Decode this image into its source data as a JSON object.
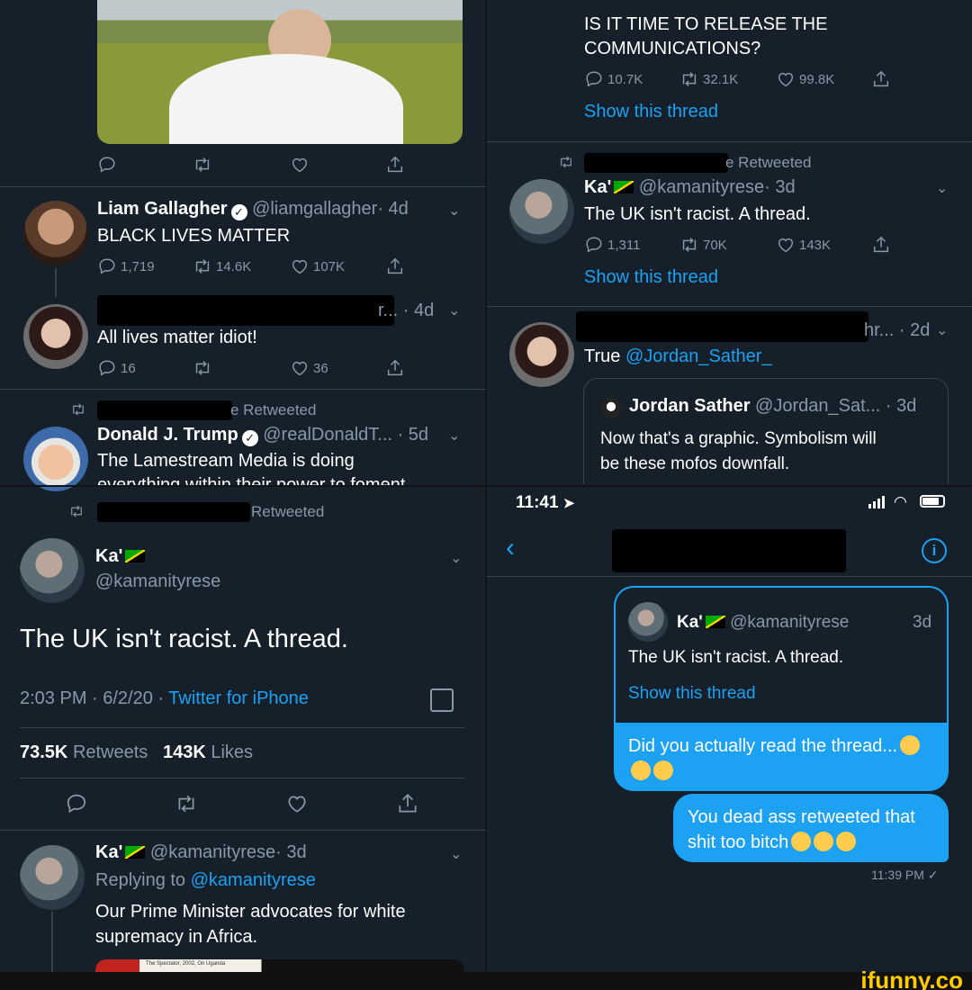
{
  "top_left": {
    "liam": {
      "name": "Liam Gallagher",
      "handle": "@liamgallagher",
      "age": "· 4d",
      "text": "BLACK LIVES MATTER",
      "replies": "1,719",
      "retweets": "14.6K",
      "likes": "107K"
    },
    "reply": {
      "name_suffix": "r...",
      "age": "· 4d",
      "text": "All lives matter idiot!",
      "replies": "16",
      "likes": "36"
    },
    "trump": {
      "retweet_label": "e Retweeted",
      "name": "Donald J. Trump",
      "handle": "@realDonaldT...",
      "age": "· 5d",
      "text": "The Lamestream Media is doing",
      "text2": "everything within their power to foment"
    }
  },
  "top_right": {
    "top_tweet": {
      "text1": "IS IT TIME TO RELEASE THE",
      "text2": "COMMUNICATIONS?",
      "replies": "10.7K",
      "retweets": "32.1K",
      "likes": "99.8K",
      "show_thread": "Show this thread"
    },
    "ka_tweet": {
      "retweet_label": "e Retweeted",
      "name": "Ka'",
      "handle": "@kamanityrese",
      "age": "· 3d",
      "text": "The UK isn't racist. A thread.",
      "replies": "1,311",
      "retweets": "70K",
      "likes": "143K",
      "show_thread": "Show this thread"
    },
    "true_tweet": {
      "name_suffix": "hr...",
      "age": "· 2d",
      "text": "True",
      "mention": "@Jordan_Sather_",
      "quote": {
        "name": "Jordan Sather",
        "handle": "@Jordan_Sat...",
        "age": "· 3d",
        "text1": "Now that's a graphic. Symbolism will",
        "text2": "be these mofos downfall."
      }
    }
  },
  "bottom_left": {
    "retweet_label": "Retweeted",
    "name": "Ka'",
    "handle": "@kamanityrese",
    "text": "The UK isn't racist. A thread.",
    "meta_time": "2:03 PM · 6/2/20 ·",
    "meta_source": "Twitter for iPhone",
    "retweets_count": "73.5K",
    "retweets_label": "Retweets",
    "likes_count": "143K",
    "likes_label": "Likes",
    "reply": {
      "name": "Ka'",
      "handle": "@kamanityrese",
      "age": "· 3d",
      "replying_to": "Replying to",
      "replying_handle": "@kamanityrese",
      "text1": "Our Prime Minister advocates for white",
      "text2": "supremacy in Africa.",
      "image_caption": "The Spectator, 2002, On Uganda"
    }
  },
  "bottom_right": {
    "status_time": "11:41",
    "shared": {
      "name": "Ka'",
      "handle": "@kamanityrese",
      "age": "3d",
      "text": "The UK isn't racist. A thread.",
      "show_thread": "Show this thread"
    },
    "msg1": "Did you actually read the thread...",
    "msg2_line1": "You dead ass retweeted that",
    "msg2_line2": "shit too bitch",
    "timestamp": "11:39 PM ✓"
  },
  "watermark": "ifunny.co",
  "colors": {
    "background": "#15202b",
    "accent": "#1da1f2",
    "muted": "#8899a6"
  }
}
